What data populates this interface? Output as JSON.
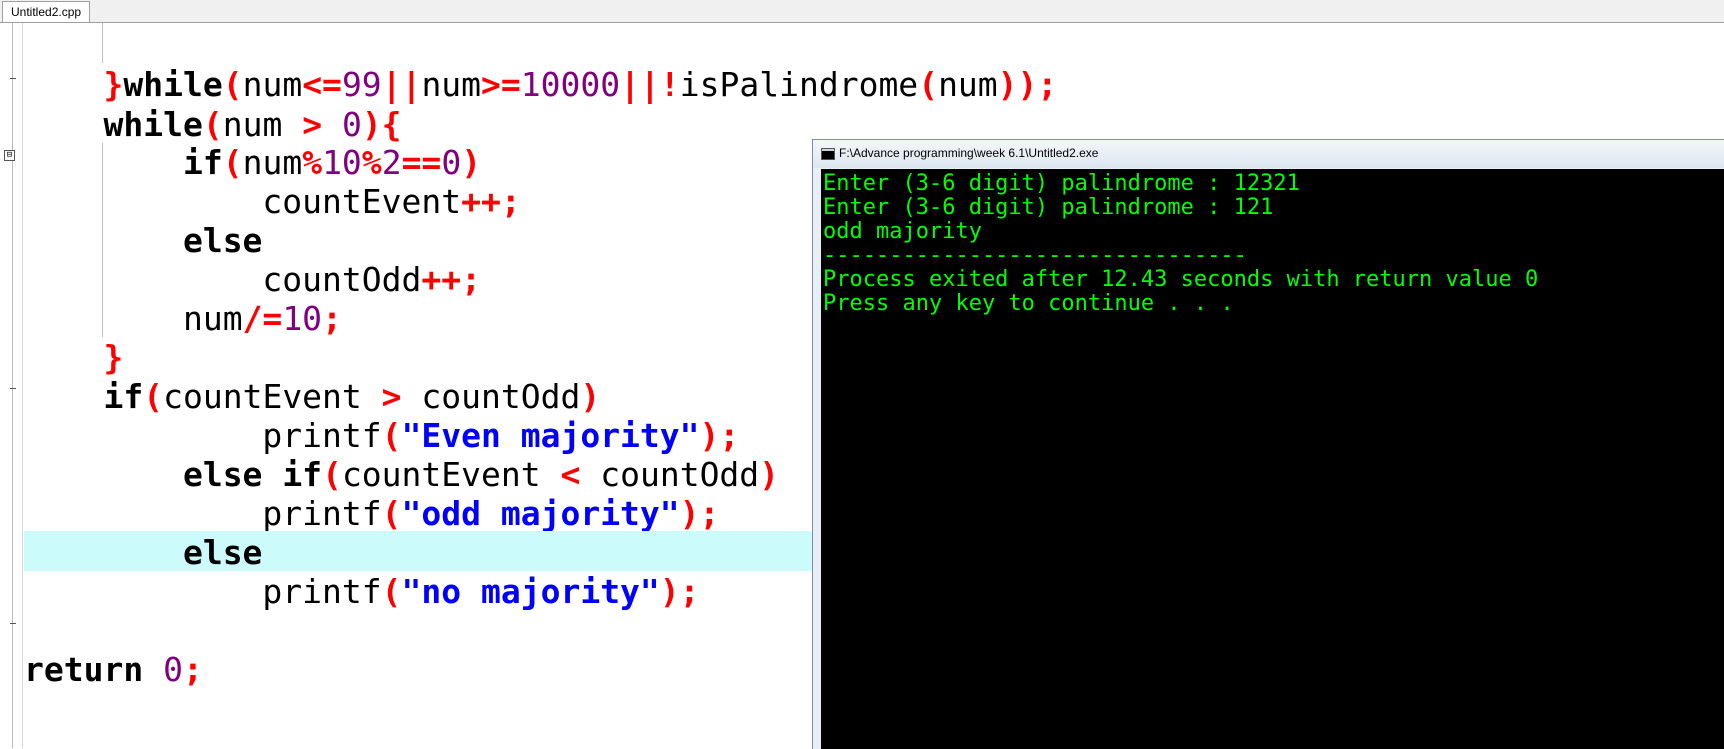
{
  "tab": {
    "label": "Untitled2.cpp"
  },
  "gutter": {
    "fold_glyph": "⊟"
  },
  "code": {
    "line1": {
      "a": "}",
      "b": "while",
      "c": "(",
      "d": "num",
      "e": "<=",
      "f": "99",
      "g": "||",
      "h": "num",
      "i": ">=",
      "j": "10000",
      "k": "||",
      "l": "!",
      "m": "isPalindrome",
      "n": "(",
      "o": "num",
      "p": "));"
    },
    "line2": {
      "a": "while",
      "b": "(",
      "c": "num ",
      "d": ">",
      "e": " ",
      "f": "0",
      "g": "){"
    },
    "line3": {
      "a": "if",
      "b": "(",
      "c": "num",
      "d": "%",
      "e": "10",
      "f": "%",
      "g": "2",
      "h": "==",
      "i": "0",
      "j": ")"
    },
    "line4": {
      "a": "countEvent",
      "b": "++;"
    },
    "line5": {
      "a": "else"
    },
    "line6": {
      "a": "countOdd",
      "b": "++;"
    },
    "line7": {
      "a": "num",
      "b": "/=",
      "c": "10",
      "d": ";"
    },
    "line8": {
      "a": "}"
    },
    "line9": {
      "a": "if",
      "b": "(",
      "c": "countEvent ",
      "d": ">",
      "e": " countOdd",
      "f": ")"
    },
    "line10": {
      "a": "printf",
      "b": "(",
      "c": "\"Even majority\"",
      "d": ");"
    },
    "line11": {
      "a": "else",
      "b": " ",
      "c": "if",
      "d": "(",
      "e": "countEvent ",
      "f": "<",
      "g": " countOdd",
      "h": ")"
    },
    "line12": {
      "a": "printf",
      "b": "(",
      "c": "\"odd majority\"",
      "d": ");"
    },
    "line13": {
      "a": "else"
    },
    "line14": {
      "a": "printf",
      "b": "(",
      "c": "\"no majority\"",
      "d": ");"
    },
    "line15": {
      "a": "return",
      "b": " ",
      "c": "0",
      "d": ";"
    }
  },
  "console": {
    "title": "F:\\Advance programming\\week 6.1\\Untitled2.exe",
    "lines": [
      "Enter (3-6 digit) palindrome : 12321",
      "Enter (3-6 digit) palindrome : 121",
      "odd majority",
      "--------------------------------",
      "Process exited after 12.43 seconds with return value 0",
      "Press any key to continue . . ."
    ]
  }
}
